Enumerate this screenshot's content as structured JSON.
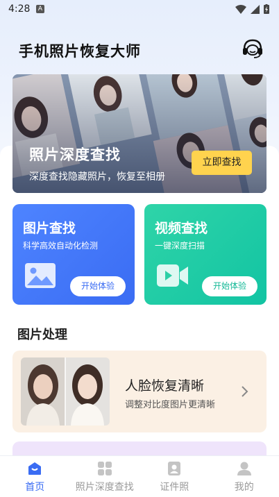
{
  "status_bar": {
    "time": "4:28",
    "notification_letter": "A"
  },
  "header": {
    "title": "手机照片恢复大师",
    "support_icon": "headset-icon"
  },
  "hero": {
    "title": "照片深度查找",
    "subtitle": "深度查找隐藏照片，恢复至相册",
    "button_label": "立即查找",
    "button_color": "#ffd34e"
  },
  "features": [
    {
      "title": "图片查找",
      "subtitle": "科学高效自动化检测",
      "button_label": "开始体验",
      "icon": "image-icon",
      "color": "#4e84ff"
    },
    {
      "title": "视频查找",
      "subtitle": "一键深度扫描",
      "button_label": "开始体验",
      "icon": "video-camera-icon",
      "color": "#12c4a3"
    }
  ],
  "section": {
    "title": "图片处理"
  },
  "tools": [
    {
      "title": "人脸恢复清晰",
      "subtitle": "调整对比度图片更清晰",
      "icon": "chevron-right-icon"
    }
  ],
  "tabbar": {
    "items": [
      {
        "label": "首页",
        "icon": "home-icon",
        "active": true
      },
      {
        "label": "照片深度查找",
        "icon": "grid-icon",
        "active": false
      },
      {
        "label": "证件照",
        "icon": "id-photo-icon",
        "active": false
      },
      {
        "label": "我的",
        "icon": "user-icon",
        "active": false
      }
    ],
    "active_color": "#3a6cf3"
  }
}
